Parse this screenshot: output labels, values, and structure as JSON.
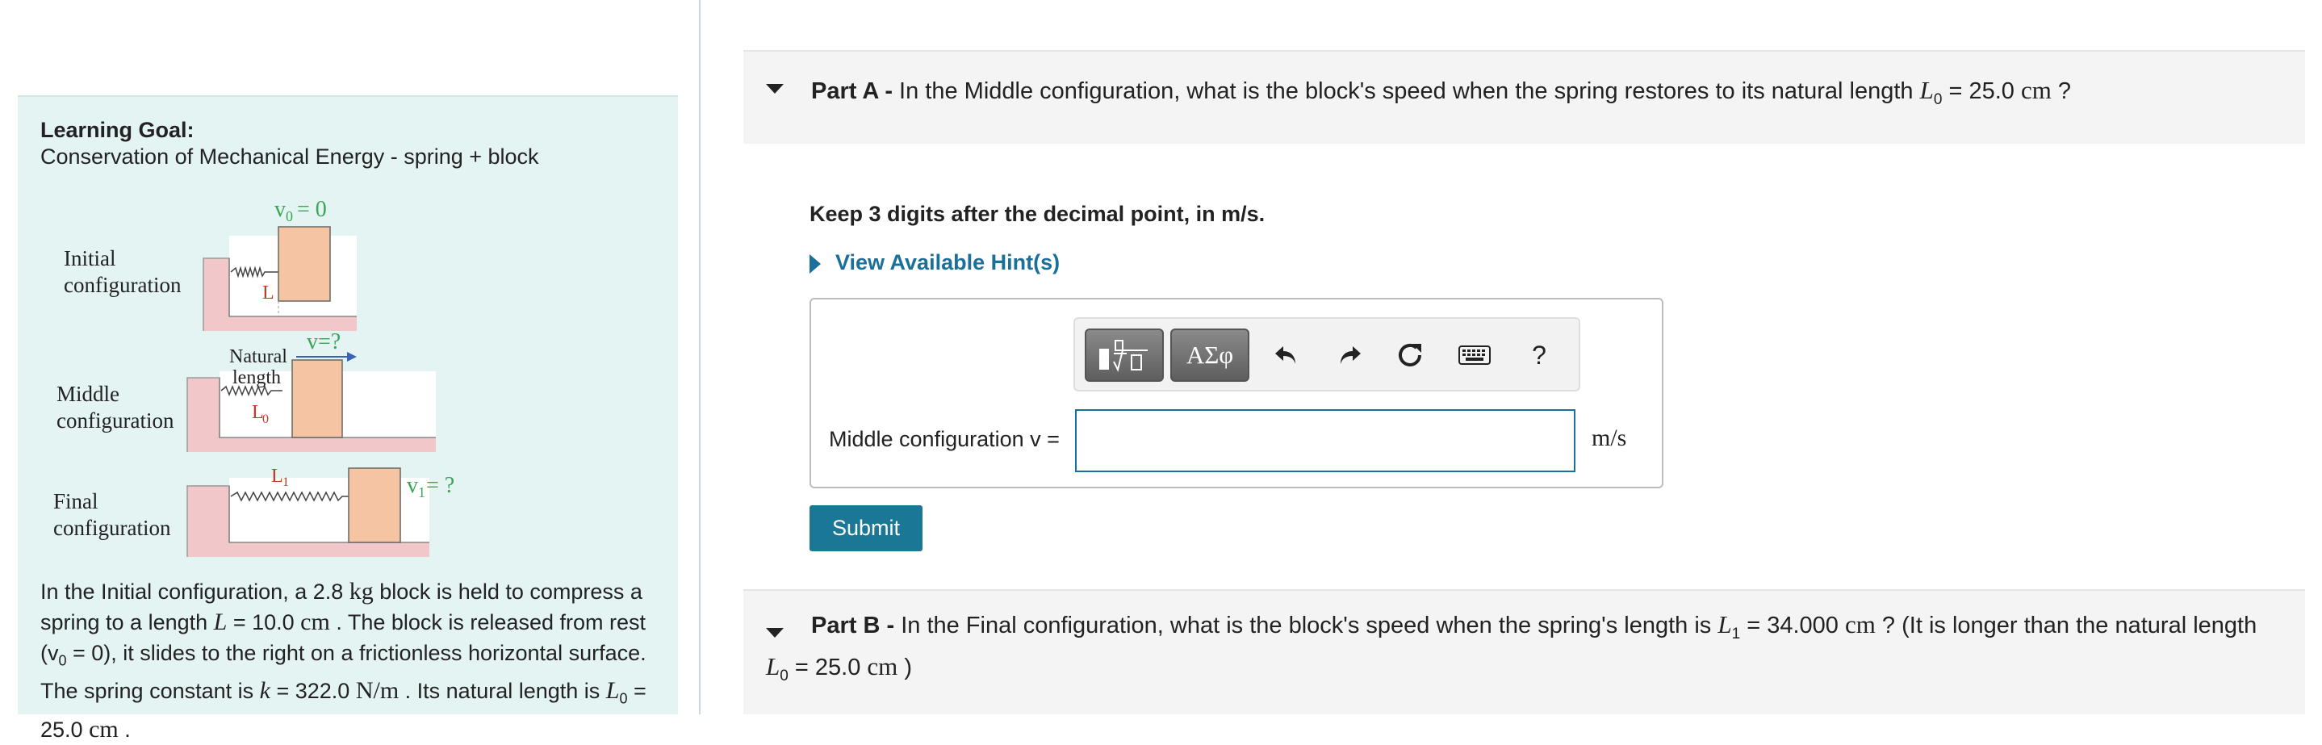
{
  "learning_goal": {
    "title": "Learning Goal:",
    "subtitle": "Conservation of Mechanical Energy - spring + block"
  },
  "figure": {
    "initial_label_1": "Initial",
    "initial_label_2": "configuration",
    "middle_label_1": "Middle",
    "middle_label_2": "configuration",
    "final_label_1": "Final",
    "final_label_2": "configuration",
    "v0_label": "v",
    "v0_sub": "0",
    "v0_value": "= 0",
    "L_label": "L",
    "natural_length_1": "Natural",
    "natural_length_2": "length",
    "v_question": "v=?",
    "L0_label": "L",
    "L0_sub": "0",
    "L1_label": "L",
    "L1_sub": "1",
    "v1_label": "v",
    "v1_sub": "1",
    "v1_value": "= ?",
    "colors": {
      "block": "#f5c4a3",
      "floor": "#f2c7c9",
      "green": "#3aa655",
      "red": "#c0392b",
      "arrow": "#3a63b8"
    }
  },
  "problem": {
    "t1": "In the Initial configuration, a 2.8 ",
    "t1_unit": "kg",
    "t2": " block is held to compress a spring to a length ",
    "t2_var": "L",
    "t2_eq": " = 10.0 ",
    "t2_unit": "cm",
    "t3": " . The block is released from rest (v",
    "t3_sub": "0",
    "t4": " = 0), it slides to the right on a frictionless horizontal surface. The spring constant is ",
    "t4_var": "k",
    "t4_eq": " = 322.0 ",
    "t4_unit": "N/m",
    "t5": " . Its natural length is ",
    "t5_var": "L",
    "t5_sub": "0",
    "t5_eq": " = 25.0 ",
    "t5_unit": "cm",
    "t6": " ."
  },
  "part_a": {
    "label": "Part A -",
    "question": " In the Middle configuration, what is the block's speed when the spring restores to its natural length ",
    "var": "L",
    "var_sub": "0",
    "eq": " = 25.0 ",
    "unit": "cm",
    "end": " ?",
    "instruction": "Keep 3 digits after the decimal point, in m/s.",
    "hint": "View Available Hint(s)",
    "input_label": "Middle configuration  v =",
    "input_value": "",
    "answer_unit": "m/s",
    "submit": "Submit"
  },
  "toolbar": {
    "templates_icon": "templates-icon",
    "greek_label": "ΑΣφ",
    "undo_icon": "undo-icon",
    "redo_icon": "redo-icon",
    "reset_icon": "reset-icon",
    "keyboard_icon": "keyboard-icon",
    "help_label": "?"
  },
  "part_b": {
    "label": "Part B -",
    "question": " In the Final configuration, what is the block's speed when the spring's length is ",
    "var": "L",
    "var_sub": "1",
    "eq": " = 34.000 ",
    "unit": "cm",
    "mid": " ? (It is longer than the natural length ",
    "var2": "L",
    "var2_sub": "0",
    "eq2": " = 25.0 ",
    "unit2": "cm",
    "end": " )"
  }
}
